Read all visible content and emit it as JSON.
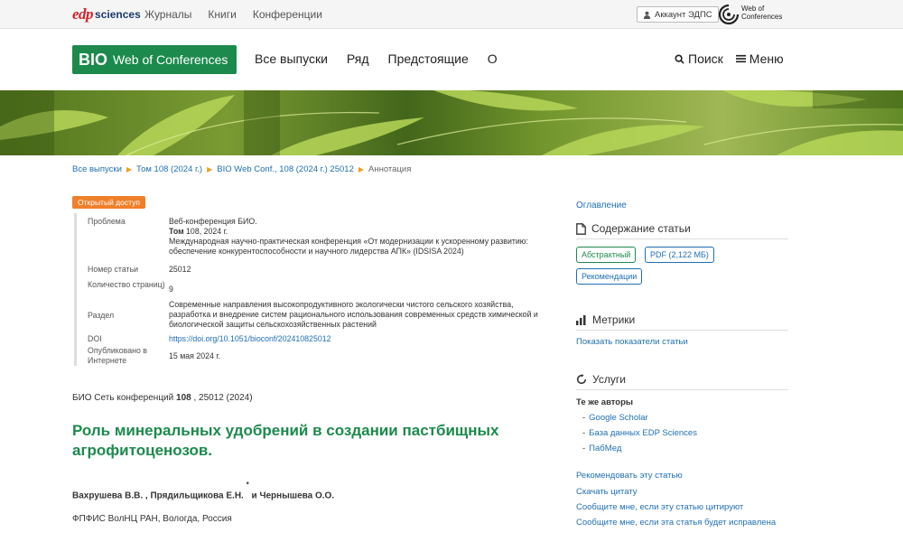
{
  "topbar": {
    "logo_mark": "edp",
    "logo_word": "sciences",
    "nav": [
      "Журналы",
      "Книги",
      "Конференции"
    ],
    "account": "Аккаунт ЭДПС",
    "woc_line1": "Web of",
    "woc_line2": "Conferences"
  },
  "header": {
    "logo_bio": "BIO",
    "logo_rest": "Web of Conferences",
    "nav": [
      "Все выпуски",
      "Ряд",
      "Предстоящие",
      "О"
    ],
    "search": "Поиск",
    "menu": "Меню"
  },
  "breadcrumb": [
    "Все выпуски",
    "Том 108 (2024 г.)",
    "BIO Web Conf., 108 (2024 г.) 25012",
    "Аннотация"
  ],
  "badge": "Открытый доступ",
  "meta": {
    "issue_label": "Проблема",
    "issue_line1": "Веб-конференция БИО.",
    "issue_vol_bold": "Том",
    "issue_vol_rest": " 108, 2024 г.",
    "issue_line3": "Международная научно-практическая конференция «От модернизации к ускоренному развитию: обеспечение конкурентоспособности и научного лидерства АПК» (IDSISA 2024)",
    "article_label": "Номер статьи",
    "article_val": "25012",
    "pages_label": "Количество страниц)",
    "pages_val": "9",
    "section_label": "Раздел",
    "section_val": "Современные направления высокопродуктивного экологически чистого сельского хозяйства, разработка и внедрение систем рационального использования современных средств химической и биологической защиты сельскохозяйственных растений",
    "doi_label": "DOI",
    "doi_val": "https://doi.org/10.1051/bioconf/202410825012",
    "pub_label": "Опубликовано в Интернете",
    "pub_val": "15 мая 2024 г."
  },
  "citation": {
    "prefix": "БИО Сеть конференций ",
    "vol": "108",
    "suffix": " , 25012 (2024)"
  },
  "title": "Роль минеральных удобрений в создании пастбищных агрофитоценозов.",
  "authors": {
    "part1": "Вахрушева В.В. , Прядильщикова Е.Н.",
    "star": "*",
    "part2": "и Чернышева О.О."
  },
  "affiliation": "ФПФИС ВолНЦ РАН, Вологда, Россия",
  "sidebar": {
    "toc": "Оглавление",
    "content_head": "Содержание статьи",
    "btn_abstract": "Абстрактный",
    "btn_pdf": "PDF (2,122 МБ)",
    "btn_reco": "Рекомендации",
    "metrics_head": "Метрики",
    "metrics_link": "Показать показатели статьи",
    "services_head": "Услуги",
    "same_authors": "Те же авторы",
    "sub_links": [
      "Google Scholar",
      "База данных EDP Sciences",
      "ПабМед"
    ],
    "links": [
      "Рекомендовать эту статью",
      "Скачать цитату",
      "Сообщите мне, если эту статью цитируют",
      "Сообщите мне, если эта статья будет исправлена"
    ]
  }
}
